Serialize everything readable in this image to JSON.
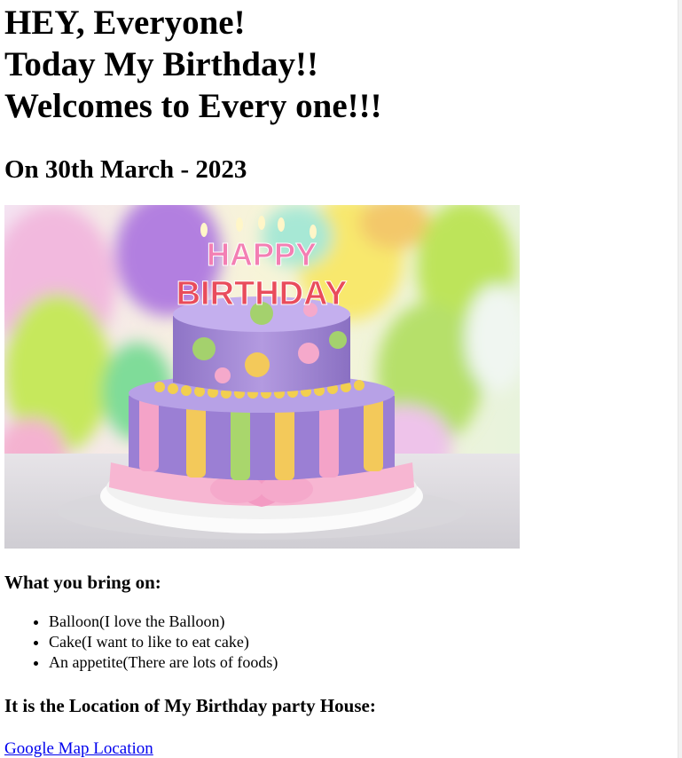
{
  "headline": {
    "line1": "HEY, Everyone!",
    "line2": "Today My Birthday!!",
    "line3": "Welcomes to Every one!!!"
  },
  "date_heading": "On 30th March - 2023",
  "cake_image": {
    "topper_line1": "HAPPY",
    "topper_line2": "BIRTHDAY"
  },
  "bring_section": {
    "heading": "What you bring on:",
    "items": [
      "Balloon(I love the Balloon)",
      "Cake(I want to like to eat cake)",
      "An appetite(There are lots of foods)"
    ]
  },
  "location_section": {
    "heading": "It is the Location of My Birthday party House:",
    "link_label": "Google Map Location"
  },
  "colors": {
    "link": "#0000ee",
    "text": "#000000",
    "background": "#ffffff"
  }
}
